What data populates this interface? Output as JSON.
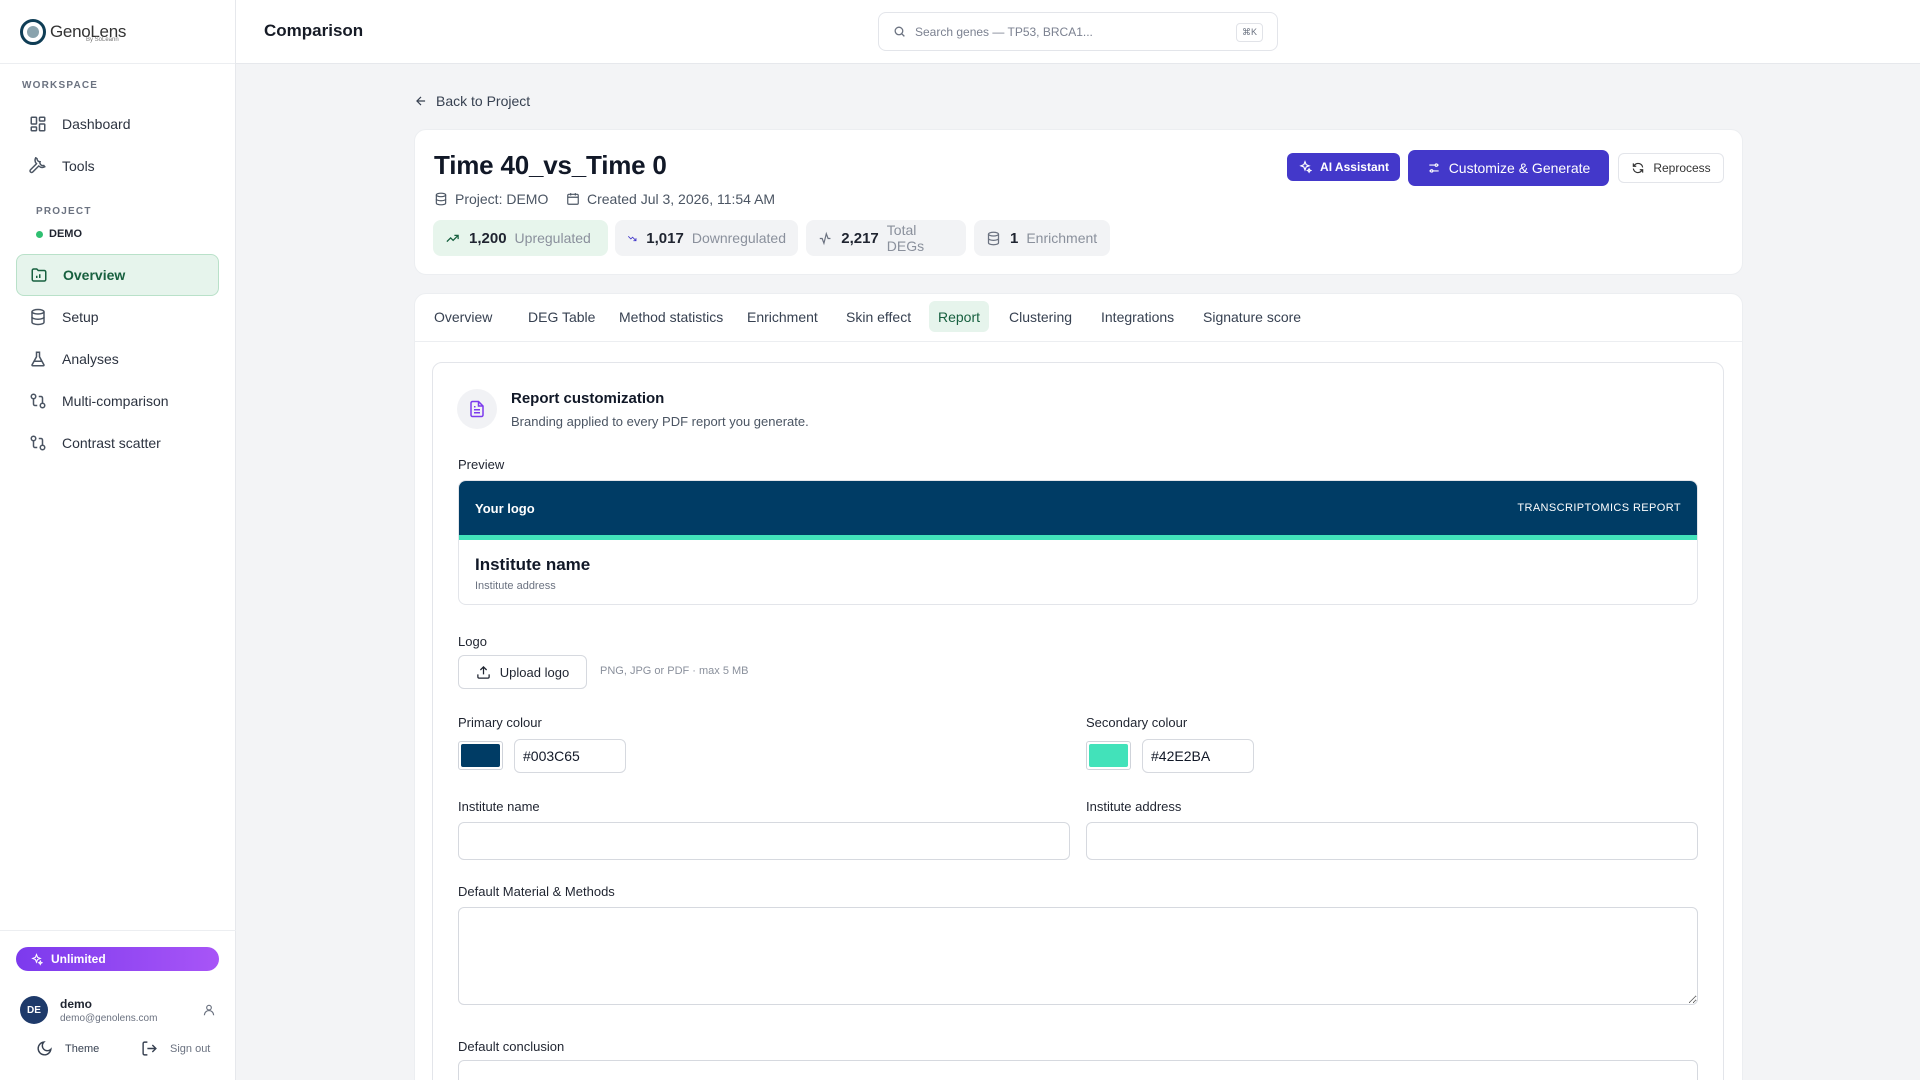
{
  "brand": {
    "name": "GenoLens",
    "sub": "By SoLeann"
  },
  "sidebar": {
    "workspace_label": "WORKSPACE",
    "workspace_items": [
      {
        "label": "Dashboard",
        "icon": "dashboard-icon"
      },
      {
        "label": "Tools",
        "icon": "wrench-icon"
      }
    ],
    "project_label": "PROJECT",
    "project_name": "DEMO",
    "project_items": [
      {
        "label": "Overview",
        "icon": "folder-chart-icon",
        "active": true
      },
      {
        "label": "Setup",
        "icon": "database-icon"
      },
      {
        "label": "Analyses",
        "icon": "flask-icon"
      },
      {
        "label": "Multi-comparison",
        "icon": "git-compare-icon"
      },
      {
        "label": "Contrast scatter",
        "icon": "git-compare-icon"
      }
    ],
    "plan_label": "Unlimited",
    "user": {
      "initials": "DE",
      "name": "demo",
      "email": "demo@genolens.com"
    },
    "theme_label": "Theme",
    "signout_label": "Sign out"
  },
  "header": {
    "title": "Comparison",
    "search_placeholder": "Search genes — TP53, BRCA1...",
    "search_shortcut": "⌘K"
  },
  "back_label": "Back to Project",
  "comparison": {
    "title": "Time 40_vs_Time 0",
    "project_meta": "Project: DEMO",
    "created_meta": "Created Jul 3, 2026, 11:54 AM",
    "stats": [
      {
        "value": "1,200",
        "label": "Upregulated",
        "icon": "trending-up-icon"
      },
      {
        "value": "1,017",
        "label": "Downregulated",
        "icon": "trending-down-icon"
      },
      {
        "value": "2,217",
        "label": "Total DEGs",
        "icon": "activity-icon"
      },
      {
        "value": "1",
        "label": "Enrichment",
        "icon": "database-icon"
      }
    ],
    "actions": {
      "ai_label": "AI Assistant",
      "generate_label": "Customize & Generate",
      "reprocess_label": "Reprocess"
    }
  },
  "tabs": [
    "Overview",
    "DEG Table",
    "Method statistics",
    "Enrichment",
    "Skin effect",
    "Report",
    "Clustering",
    "Integrations",
    "Signature score"
  ],
  "active_tab": "Report",
  "report": {
    "title": "Report customization",
    "subtitle": "Branding applied to every PDF report you generate.",
    "preview_label": "Preview",
    "preview": {
      "logo_text": "Your logo",
      "report_type": "TRANSCRIPTOMICS REPORT",
      "institute_name": "Institute name",
      "institute_address": "Institute address"
    },
    "logo_label": "Logo",
    "upload_label": "Upload logo",
    "upload_hint": "PNG, JPG or PDF · max 5 MB",
    "primary_label": "Primary colour",
    "primary_value": "#003C65",
    "secondary_label": "Secondary colour",
    "secondary_value": "#42E2BA",
    "institute_name_label": "Institute name",
    "institute_name_value": "",
    "institute_address_label": "Institute address",
    "institute_address_value": "",
    "methods_label": "Default Material & Methods",
    "conclusion_label": "Default conclusion"
  },
  "colors": {
    "primary": "#003C65",
    "secondary": "#42E2BA",
    "accent": "#4338CA",
    "active_green": "#17603F"
  }
}
